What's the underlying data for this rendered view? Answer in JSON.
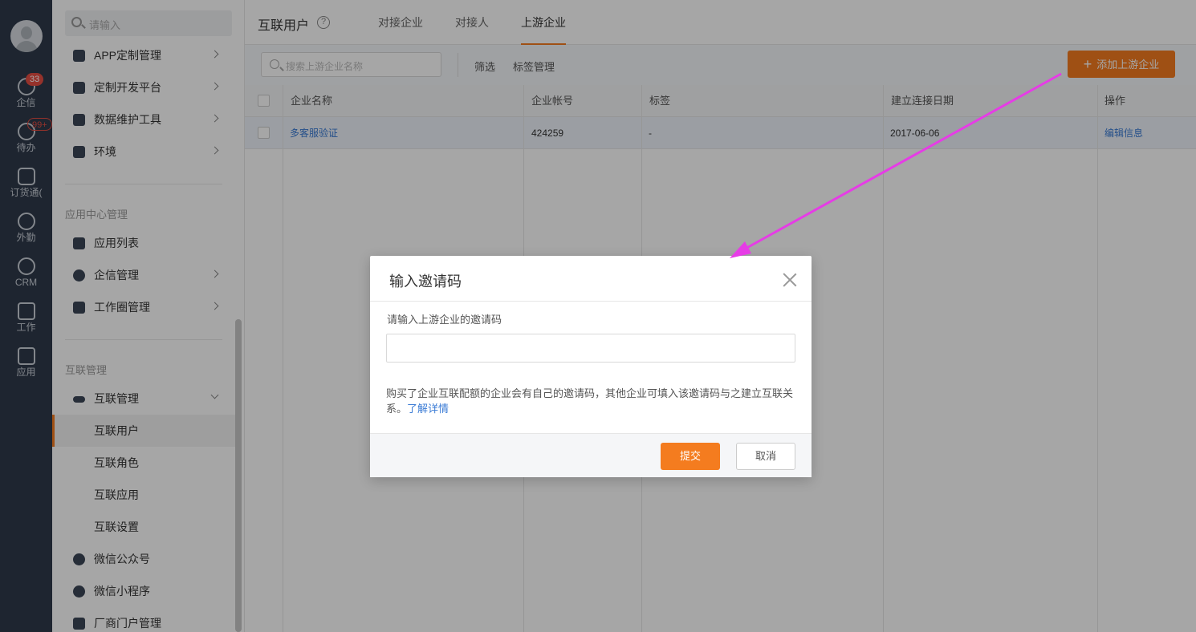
{
  "rail": {
    "items": [
      {
        "label": "企信",
        "icon": "chat-icon",
        "badge": "33"
      },
      {
        "label": "待办",
        "icon": "check-circle-icon",
        "badge": "99+"
      },
      {
        "label": "订货通(",
        "icon": "order-icon"
      },
      {
        "label": "外勤",
        "icon": "location-icon"
      },
      {
        "label": "CRM",
        "icon": "clock-icon"
      },
      {
        "label": "工作",
        "icon": "briefcase-icon"
      },
      {
        "label": "应用",
        "icon": "grid-icon"
      }
    ]
  },
  "sidebar": {
    "search_placeholder": "请输入",
    "items_top": [
      {
        "label": "APP定制管理",
        "icon": "app-settings-icon"
      },
      {
        "label": "定制开发平台",
        "icon": "code-icon"
      },
      {
        "label": "数据维护工具",
        "icon": "bar-chart-icon"
      },
      {
        "label": "环境",
        "icon": "pulse-icon"
      }
    ],
    "group_app_center": "应用中心管理",
    "items_app_center": [
      {
        "label": "应用列表",
        "icon": "apps-icon"
      },
      {
        "label": "企信管理",
        "icon": "message-icon"
      },
      {
        "label": "工作圈管理",
        "icon": "edit-icon"
      }
    ],
    "group_interconnect": "互联管理",
    "interconnect_parent": {
      "label": "互联管理",
      "icon": "link-icon"
    },
    "interconnect_children": [
      "互联用户",
      "互联角色",
      "互联应用",
      "互联设置"
    ],
    "items_bottom": [
      {
        "label": "微信公众号",
        "icon": "wechat-icon"
      },
      {
        "label": "微信小程序",
        "icon": "miniprogram-icon"
      },
      {
        "label": "厂商门户管理",
        "icon": "building-icon"
      }
    ]
  },
  "header": {
    "title": "互联用户",
    "help": "?",
    "tabs": [
      "对接企业",
      "对接人",
      "上游企业"
    ],
    "active_tab": "上游企业"
  },
  "toolbar": {
    "search_placeholder": "搜索上游企业名称",
    "filter": "筛选",
    "tag_manage": "标签管理",
    "add_button": "添加上游企业"
  },
  "table": {
    "columns": [
      "企业名称",
      "企业帐号",
      "标签",
      "建立连接日期",
      "操作"
    ],
    "rows": [
      {
        "name": "多客服验证",
        "account": "424259",
        "tag": "-",
        "date": "2017-06-06",
        "action": "编辑信息"
      }
    ]
  },
  "modal": {
    "title": "输入邀请码",
    "label": "请输入上游企业的邀请码",
    "input_value": "",
    "description": "购买了企业互联配额的企业会有自己的邀请码，其他企业可填入该邀请码与之建立互联关系。",
    "learn_more": "了解详情",
    "submit": "提交",
    "cancel": "取消"
  },
  "colors": {
    "accent": "#f47c1f",
    "link": "#3a7bd5",
    "rail_bg": "#2f3a4a",
    "annotation_arrow": "#e63ce6"
  }
}
